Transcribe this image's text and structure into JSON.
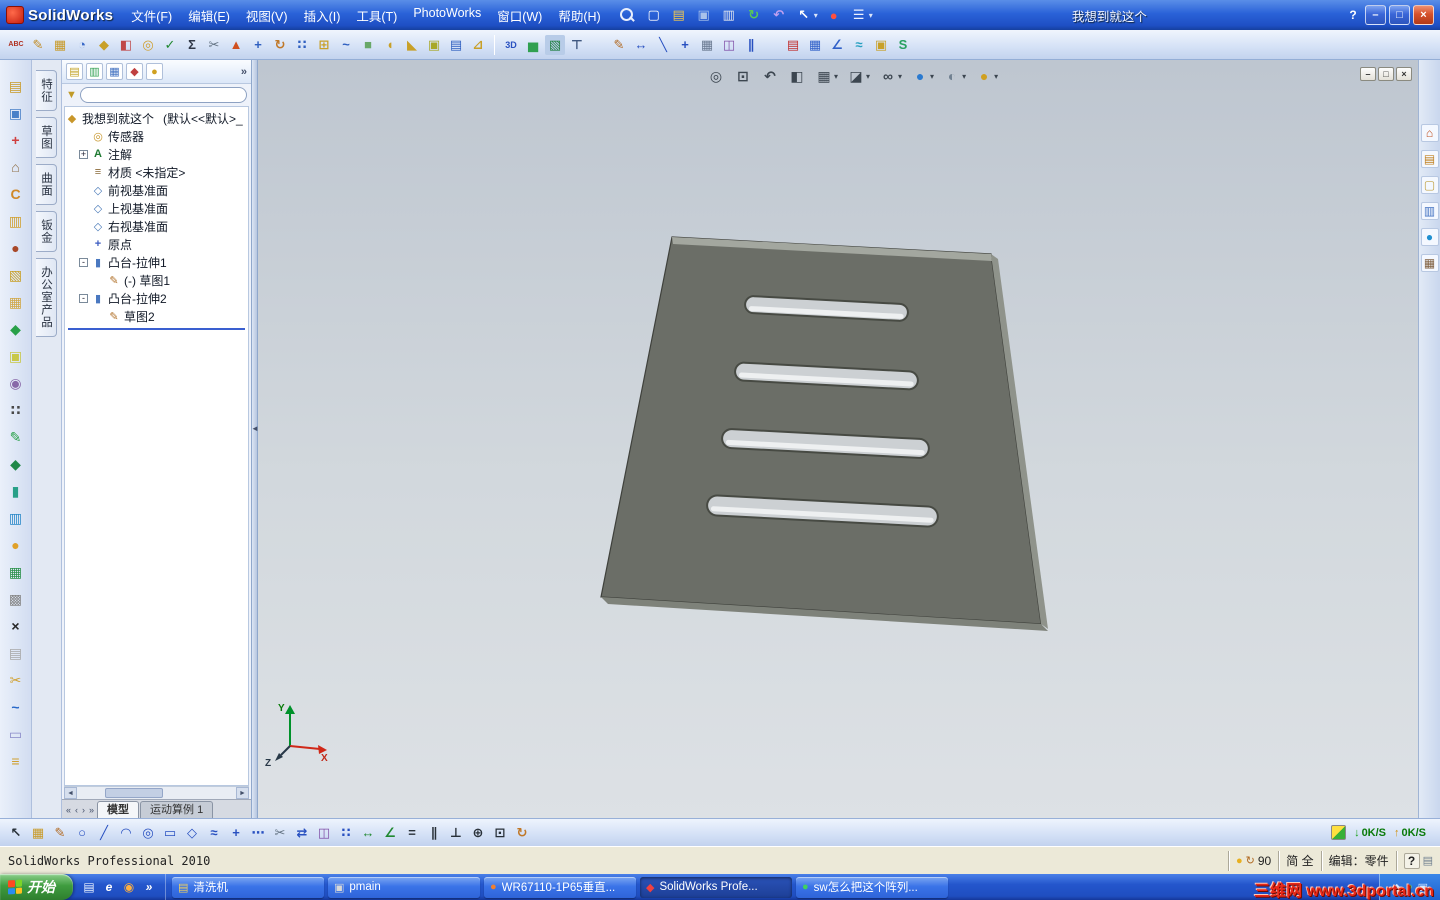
{
  "titlebar": {
    "logo": "SolidWorks",
    "menus": [
      {
        "label": "文件(F)"
      },
      {
        "label": "编辑(E)"
      },
      {
        "label": "视图(V)"
      },
      {
        "label": "插入(I)"
      },
      {
        "label": "工具(T)"
      },
      {
        "label": "PhotoWorks"
      },
      {
        "label": "窗口(W)"
      },
      {
        "label": "帮助(H)"
      }
    ],
    "tools": [
      {
        "n": "new-document-icon",
        "g": "▢",
        "c": "#ffffff"
      },
      {
        "n": "open-folder-icon",
        "g": "▤",
        "c": "#f2c84e"
      },
      {
        "n": "save-icon",
        "g": "▣",
        "c": "#a9c2ea"
      },
      {
        "n": "print-icon",
        "g": "▥",
        "c": "#e0e4ee"
      },
      {
        "n": "rebuild-icon",
        "g": "↻",
        "c": "#58c858"
      },
      {
        "n": "undo-icon",
        "g": "↶",
        "c": "#c0a0f0"
      },
      {
        "n": "select-arrow-icon",
        "g": "↖",
        "c": "#ffffff",
        "dd": "▾"
      },
      {
        "n": "record-macro-icon",
        "g": "●",
        "c": "#ff5040"
      },
      {
        "n": "options-icon",
        "g": "☰",
        "c": "#eef2ff",
        "dd": "▾"
      }
    ],
    "doc_title": "我想到就这个",
    "help_label": "?",
    "win": {
      "min": "–",
      "max": "□",
      "close": "×"
    }
  },
  "toolbar": {
    "group1": [
      {
        "n": "spell-check-icon",
        "g": "ABC",
        "c": "#b03020",
        "fs": "7px"
      },
      {
        "n": "format-painter-icon",
        "g": "✎",
        "c": "#c08a20"
      },
      {
        "n": "design-table-icon",
        "g": "▦",
        "c": "#c89a28"
      },
      {
        "n": "measure-icon",
        "g": "◔",
        "c": "#3868c8"
      },
      {
        "n": "mass-properties-icon",
        "g": "◆",
        "c": "#c8a028"
      },
      {
        "n": "section-properties-icon",
        "g": "◧",
        "c": "#c04848"
      },
      {
        "n": "sensor-icon",
        "g": "◎",
        "c": "#d0a030"
      },
      {
        "n": "check-entity-icon",
        "g": "✓",
        "c": "#208830"
      },
      {
        "n": "equations-icon",
        "g": "Σ",
        "c": "#303848"
      },
      {
        "n": "cut-icon",
        "g": "✂",
        "c": "#607080"
      },
      {
        "n": "error-check-icon",
        "g": "▲",
        "c": "#d05020"
      },
      {
        "n": "translate-icon",
        "g": "+",
        "c": "#3060c0"
      },
      {
        "n": "rotate-icon",
        "g": "↻",
        "c": "#c07828"
      },
      {
        "n": "pattern-icon",
        "g": "∷",
        "c": "#3060c0"
      },
      {
        "n": "reference-geometry-icon",
        "g": "⊞",
        "c": "#c8a028"
      },
      {
        "n": "curve-icon",
        "g": "~",
        "c": "#3060c0"
      },
      {
        "n": "instant3d-icon",
        "g": "■",
        "c": "#68a868"
      },
      {
        "n": "fillet-icon",
        "g": "◖",
        "c": "#c8a028"
      },
      {
        "n": "chamfer-icon",
        "g": "◣",
        "c": "#c8a028"
      },
      {
        "n": "shell-icon",
        "g": "▣",
        "c": "#a8a828"
      },
      {
        "n": "rib-icon",
        "g": "▤",
        "c": "#3060c0"
      },
      {
        "n": "draft-icon",
        "g": "⊿",
        "c": "#c8a028"
      }
    ],
    "group2": [
      {
        "n": "3d-sketch-icon",
        "g": "3D",
        "c": "#2850c0",
        "fs": "9px"
      },
      {
        "n": "chart-icon",
        "g": "▅",
        "c": "#30a050"
      },
      {
        "n": "render-preview-icon",
        "g": "▧",
        "c": "#208040",
        "b": "#b8cce8"
      },
      {
        "n": "drafting-standard-icon",
        "g": "⊤",
        "c": "#405880"
      }
    ],
    "group3": [
      {
        "n": "sketch-pencil-icon",
        "g": "✎",
        "c": "#b06820"
      },
      {
        "n": "smart-dimension-icon",
        "g": "↔",
        "c": "#2850c0"
      },
      {
        "n": "line-icon",
        "g": "╲",
        "c": "#2850c0"
      },
      {
        "n": "point-icon",
        "g": "+",
        "c": "#2850c0"
      },
      {
        "n": "grid-icon",
        "g": "▦",
        "c": "#687890"
      },
      {
        "n": "mirror-entities-icon",
        "g": "◫",
        "c": "#8050a8"
      },
      {
        "n": "offset-entities-icon",
        "g": "∥",
        "c": "#2850c0"
      }
    ],
    "group4": [
      {
        "n": "exploded-view-icon",
        "g": "▤",
        "c": "#c03030"
      },
      {
        "n": "drawing-sheet-icon",
        "g": "▦",
        "c": "#3060c8"
      },
      {
        "n": "route-line-icon",
        "g": "∠",
        "c": "#3060c8"
      },
      {
        "n": "spline-icon",
        "g": "≈",
        "c": "#28a0c0"
      },
      {
        "n": "blocks-icon",
        "g": "▣",
        "c": "#c8a028"
      },
      {
        "n": "belt-chain-icon",
        "g": "S",
        "c": "#28a060"
      }
    ]
  },
  "left_toolbar": [
    {
      "n": "new-part-icon",
      "g": "▤",
      "c": "#c89a28"
    },
    {
      "n": "clipboard-icon",
      "g": "▣",
      "c": "#4880c8"
    },
    {
      "n": "move-copy-icon",
      "g": "+",
      "c": "#d04040"
    },
    {
      "n": "teapot-icon",
      "g": "⌂",
      "c": "#907048"
    },
    {
      "n": "arc-tool-icon",
      "g": "C",
      "c": "#d08828"
    },
    {
      "n": "mailbox-icon",
      "g": "▥",
      "c": "#d0a030"
    },
    {
      "n": "bug-icon",
      "g": "●",
      "c": "#a84828"
    },
    {
      "n": "parts-box-icon",
      "g": "▧",
      "c": "#c8a028"
    },
    {
      "n": "crate-icon",
      "g": "▦",
      "c": "#d0a848"
    },
    {
      "n": "leaf-icon",
      "g": "◆",
      "c": "#28a048"
    },
    {
      "n": "palette-icon",
      "g": "▣",
      "c": "#c8c848"
    },
    {
      "n": "sphere-icon",
      "g": "◉",
      "c": "#8868a8"
    },
    {
      "n": "group-dots-icon",
      "g": "∷",
      "c": "#484848"
    },
    {
      "n": "green-pencil-icon",
      "g": "✎",
      "c": "#28a048"
    },
    {
      "n": "green-diamond-icon",
      "g": "◆",
      "c": "#208848"
    },
    {
      "n": "barrel-icon",
      "g": "▮",
      "c": "#28a088"
    },
    {
      "n": "database-icon",
      "g": "▥",
      "c": "#2888c8"
    },
    {
      "n": "orange-ball-icon",
      "g": "●",
      "c": "#e0a028"
    },
    {
      "n": "green-cube-icon",
      "g": "▦",
      "c": "#289048"
    },
    {
      "n": "grid-plate-icon",
      "g": "▩",
      "c": "#888888"
    },
    {
      "n": "delete-x-icon",
      "g": "×",
      "c": "#282828"
    },
    {
      "n": "sheet-icon",
      "g": "▤",
      "c": "#a8a8a8"
    },
    {
      "n": "trim-tool-icon",
      "g": "✂",
      "c": "#d0a030"
    },
    {
      "n": "curve2-icon",
      "g": "~",
      "c": "#2868c8"
    },
    {
      "n": "panel-icon",
      "g": "▭",
      "c": "#8888c8"
    },
    {
      "n": "comb-icon",
      "g": "≡",
      "c": "#d0a030"
    }
  ],
  "panel_tabs": [
    {
      "label": "特征"
    },
    {
      "label": "草图"
    },
    {
      "label": "曲面"
    },
    {
      "label": "钣金"
    },
    {
      "label": "办公室产品"
    }
  ],
  "tree": {
    "header_tabs": [
      {
        "n": "featuremanager-tab-icon",
        "g": "▤",
        "c": "#c0a020"
      },
      {
        "n": "propertymanager-tab-icon",
        "g": "▥",
        "c": "#30a050"
      },
      {
        "n": "configurationmanager-tab-icon",
        "g": "▦",
        "c": "#4070c0"
      },
      {
        "n": "dimxpertmanager-tab-icon",
        "g": "◆",
        "c": "#c04040"
      },
      {
        "n": "displaymanager-tab-icon",
        "g": "●",
        "c": "#d0a020"
      }
    ],
    "header_more": "»",
    "filter_glyph": "▼",
    "root": {
      "icon": "◆",
      "label": "我想到就这个",
      "config": "(默认<<默认>_"
    },
    "items": [
      {
        "exp": "",
        "icon": "◎",
        "ic": "#c8962a",
        "label": "传感器",
        "pad": "14px"
      },
      {
        "exp": "+",
        "icon": "A",
        "ic": "#1f7a32",
        "label": "注解",
        "pad": "14px"
      },
      {
        "exp": "",
        "icon": "≡",
        "ic": "#8a6a3a",
        "label": "材质 <未指定>",
        "pad": "14px"
      },
      {
        "exp": "",
        "icon": "◇",
        "ic": "#4a7ab8",
        "label": "前视基准面",
        "pad": "14px"
      },
      {
        "exp": "",
        "icon": "◇",
        "ic": "#4a7ab8",
        "label": "上视基准面",
        "pad": "14px"
      },
      {
        "exp": "",
        "icon": "◇",
        "ic": "#4a7ab8",
        "label": "右视基准面",
        "pad": "14px"
      },
      {
        "exp": "",
        "icon": "+",
        "ic": "#3a5ac0",
        "label": "原点",
        "pad": "14px"
      },
      {
        "exp": "-",
        "icon": "▮",
        "ic": "#4a78c0",
        "label": "凸台-拉伸1",
        "pad": "14px"
      },
      {
        "exp": "",
        "icon": "✎",
        "ic": "#b07028",
        "label": "(-) 草图1",
        "pad": "30px"
      },
      {
        "exp": "-",
        "icon": "▮",
        "ic": "#4a78c0",
        "label": "凸台-拉伸2",
        "pad": "14px"
      },
      {
        "exp": "",
        "icon": "✎",
        "ic": "#b07028",
        "label": "草图2",
        "pad": "30px"
      }
    ]
  },
  "doc_tabs": {
    "nav": [
      {
        "g": "«"
      },
      {
        "g": "‹"
      },
      {
        "g": "›"
      },
      {
        "g": "»"
      }
    ],
    "tabs": [
      {
        "label": "模型",
        "cls": "active"
      },
      {
        "label": "运动算例 1",
        "cls": ""
      }
    ]
  },
  "viewport": {
    "hud": [
      {
        "n": "zoom-fit-icon",
        "g": "◎",
        "c": "#3c4650"
      },
      {
        "n": "zoom-area-icon",
        "g": "⊡",
        "c": "#3c4650"
      },
      {
        "n": "previous-view-icon",
        "g": "↶",
        "c": "#3c4650"
      },
      {
        "n": "section-view-icon",
        "g": "◧",
        "c": "#3c4650"
      },
      {
        "n": "view-orientation-icon",
        "g": "▦",
        "c": "#3c4650",
        "dd": "▾"
      },
      {
        "n": "display-style-icon",
        "g": "◪",
        "c": "#3c4650",
        "dd": "▾"
      },
      {
        "n": "hide-show-items-icon",
        "g": "∞",
        "c": "#3c4650",
        "dd": "▾"
      },
      {
        "n": "edit-appearance-icon",
        "g": "●",
        "c": "#2a7ad0",
        "dd": "▾"
      },
      {
        "n": "apply-scene-icon",
        "g": "◐",
        "c": "#708090",
        "dd": "▾"
      },
      {
        "n": "view-settings-icon",
        "g": "●",
        "c": "#d0a020",
        "dd": "▾"
      }
    ],
    "win": {
      "min": "–",
      "max": "□",
      "close": "×"
    },
    "triad": {
      "x": "X",
      "y": "Y",
      "z": "Z"
    }
  },
  "task_pane": [
    {
      "n": "solidworks-resources-icon",
      "g": "⌂",
      "c": "#c05020"
    },
    {
      "n": "design-library-icon",
      "g": "▤",
      "c": "#c08020"
    },
    {
      "n": "file-explorer-icon",
      "g": "▢",
      "c": "#c0a040"
    },
    {
      "n": "view-palette-icon",
      "g": "▥",
      "c": "#4070c0"
    },
    {
      "n": "appearances-icon",
      "g": "●",
      "c": "#2090d0"
    },
    {
      "n": "custom-properties-icon",
      "g": "▦",
      "c": "#806040"
    }
  ],
  "sketch_toolbar": [
    {
      "n": "select-icon",
      "g": "↖",
      "c": "#283038"
    },
    {
      "n": "grid-snap-icon",
      "g": "▦",
      "c": "#c89a28"
    },
    {
      "n": "sketch-pencil-icon",
      "g": "✎",
      "c": "#b06820"
    },
    {
      "n": "circle-icon",
      "g": "○",
      "c": "#2850c0"
    },
    {
      "n": "line-tool-icon",
      "g": "╱",
      "c": "#2850c0"
    },
    {
      "n": "arc-icon",
      "g": "◠",
      "c": "#2850c0"
    },
    {
      "n": "ellipse-icon",
      "g": "◎",
      "c": "#2850c0"
    },
    {
      "n": "rectangle-icon",
      "g": "▭",
      "c": "#2850c0"
    },
    {
      "n": "polygon-icon",
      "g": "◇",
      "c": "#2850c0"
    },
    {
      "n": "spline-tool-icon",
      "g": "≈",
      "c": "#2850c0"
    },
    {
      "n": "point-tool-icon",
      "g": "+",
      "c": "#2850c0"
    },
    {
      "n": "centerline-icon",
      "g": "⋯",
      "c": "#2850c0"
    },
    {
      "n": "trim-entities-icon",
      "g": "✂",
      "c": "#607080"
    },
    {
      "n": "extend-icon",
      "g": "⇄",
      "c": "#2850c0"
    },
    {
      "n": "mirror-icon",
      "g": "◫",
      "c": "#8050a8"
    },
    {
      "n": "linear-pattern-icon",
      "g": "∷",
      "c": "#2850c0"
    },
    {
      "n": "dimension-icon",
      "g": "↔",
      "c": "#208830"
    },
    {
      "n": "angle-icon",
      "g": "∠",
      "c": "#208830"
    },
    {
      "n": "equal-icon",
      "g": "=",
      "c": "#283038"
    },
    {
      "n": "parallel-icon",
      "g": "∥",
      "c": "#283038"
    },
    {
      "n": "perpendicular-icon",
      "g": "⊥",
      "c": "#283038"
    },
    {
      "n": "coincident-icon",
      "g": "⊕",
      "c": "#283038"
    },
    {
      "n": "fix-icon",
      "g": "⊡",
      "c": "#283038"
    },
    {
      "n": "rotate-sketch-icon",
      "g": "↻",
      "c": "#c07828"
    }
  ],
  "netspeed": {
    "down_arrow": "↓",
    "down": "0K/S",
    "up_arrow": "↑",
    "up": "0K/S"
  },
  "statusbar": {
    "left": "SolidWorks Professional 2010",
    "warn_icon": "●",
    "rebuild_icon": "↻",
    "counter": "90",
    "ime": "简 全",
    "mode": "编辑：零件",
    "help": "?",
    "doc_icon": "▤"
  },
  "taskbar": {
    "start": "开始",
    "quick": [
      {
        "n": "show-desktop-icon",
        "g": "▤",
        "c": "#e8f0ff"
      },
      {
        "n": "internet-explorer-icon",
        "g": "e",
        "c": "#ffffff"
      },
      {
        "n": "media-player-icon",
        "g": "◉",
        "c": "#ffb040"
      },
      {
        "n": "expand-chevron-icon",
        "g": "»",
        "c": "#ffffff"
      }
    ],
    "tasks": [
      {
        "n": "task-qingxiji",
        "icon": "▤",
        "ic": "#f0d060",
        "label": "清洗机",
        "cls": ""
      },
      {
        "n": "task-pmain",
        "icon": "▣",
        "ic": "#d8d8d8",
        "label": "pmain",
        "cls": ""
      },
      {
        "n": "task-wr67110",
        "icon": "●",
        "ic": "#f08030",
        "label": "WR67110-1P65垂直...",
        "cls": ""
      },
      {
        "n": "task-solidworks",
        "icon": "◆",
        "ic": "#f04040",
        "label": "SolidWorks Profe...",
        "cls": "active"
      },
      {
        "n": "task-sw-question",
        "icon": "●",
        "ic": "#40d060",
        "label": "sw怎么把这个阵列...",
        "cls": ""
      }
    ],
    "tray": [
      {
        "n": "tray-icon-volume",
        "g": "◆",
        "c": "#d8e8ff"
      },
      {
        "n": "tray-icon-antivirus",
        "g": "●",
        "c": "#70d070"
      },
      {
        "n": "tray-icon-network",
        "g": "▣",
        "c": "#d8e8ff"
      }
    ],
    "watermark": "三维网 www.3dportal.cn"
  }
}
